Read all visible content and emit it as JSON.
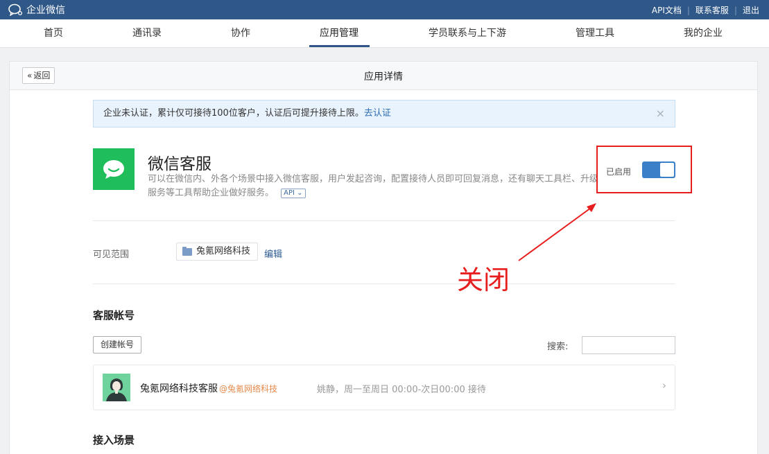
{
  "topbar": {
    "app_title": "企业微信",
    "links": [
      "API文档",
      "联系客服",
      "退出"
    ]
  },
  "nav": {
    "items": [
      "首页",
      "通讯录",
      "协作",
      "应用管理",
      "学员联系与上下游",
      "管理工具",
      "我的企业"
    ],
    "active": "应用管理"
  },
  "card": {
    "back_label": "返回",
    "title": "应用详情"
  },
  "notice": {
    "text": "企业未认证，累计仅可接待100位客户，认证后可提升接待上限。",
    "link": "去认证",
    "close_icon": "×"
  },
  "app": {
    "name": "微信客服",
    "description": "可以在微信内、外各个场景中接入微信客服，用户发起咨询，配置接待人员即可回复消息，还有聊天工具栏、升级服务等工具帮助企业做好服务。",
    "api_tag": "API",
    "status_label": "已启用",
    "enabled": true
  },
  "scope": {
    "label": "可见范围",
    "value": "兔氪网络科技",
    "edit": "编辑"
  },
  "accounts": {
    "title": "客服帐号",
    "create_button": "创建帐号",
    "search_label": "搜索:",
    "search_value": "",
    "items": [
      {
        "name": "兔氪网络科技客服",
        "corp": "@兔氪网络科技",
        "info": "姚静，周一至周日 00:00-次日00:00 接待"
      }
    ]
  },
  "scenes": {
    "title": "接入场景"
  },
  "annotation": {
    "text": "关闭",
    "color": "#e81d1d"
  },
  "colors": {
    "topbar": "#2f5788",
    "toggle_on": "#3a7fc8",
    "app_icon": "#1fbe5b",
    "link": "#2b6cb0"
  }
}
